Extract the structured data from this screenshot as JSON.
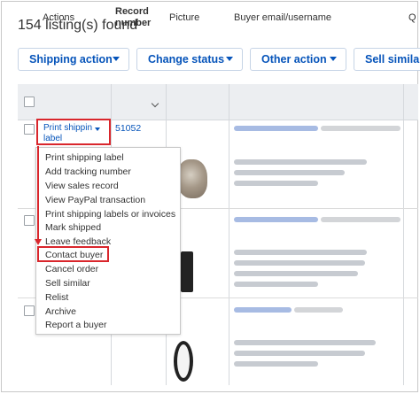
{
  "results": {
    "count_text": "154 listing(s) found"
  },
  "toolbar": {
    "shipping_action": "Shipping action",
    "change_status": "Change status",
    "other_action": "Other action",
    "sell_similar": "Sell similar"
  },
  "table": {
    "headers": {
      "actions": "Actions",
      "record_number": "Record number",
      "picture": "Picture",
      "buyer": "Buyer email/username",
      "q": "Q"
    }
  },
  "row1": {
    "print_shipping_label": "Print shippin label",
    "record_number": "51052"
  },
  "menu": {
    "items": [
      "Print shipping label",
      "Add tracking number",
      "View sales record",
      "View PayPal transaction",
      "Print shipping labels or invoices",
      "Mark shipped",
      "Leave feedback",
      "Contact buyer",
      "Cancel order",
      "Sell similar",
      "Relist",
      "Archive",
      "Report a buyer"
    ]
  },
  "colors": {
    "link": "#0654ba",
    "annotation": "#d9262c",
    "header_bg": "#eceef1"
  }
}
